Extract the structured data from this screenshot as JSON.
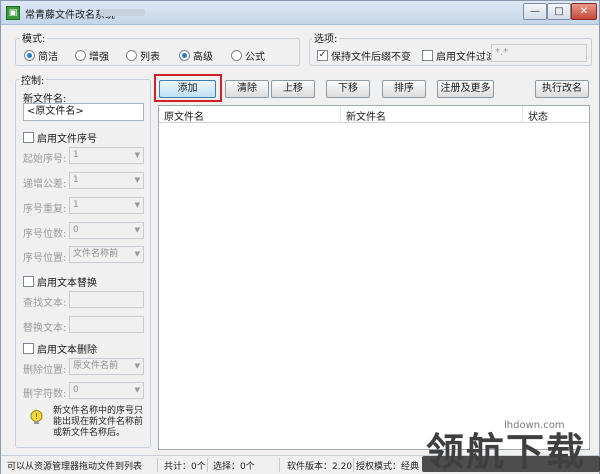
{
  "window": {
    "title": "常青藤文件改名系统",
    "icon_glyph": "▣",
    "controls": {
      "minimize": "—",
      "maximize": "□",
      "close": "✕"
    }
  },
  "mode": {
    "label": "模式:",
    "options": [
      {
        "label": "简洁",
        "selected": true
      },
      {
        "label": "增强",
        "selected": false
      },
      {
        "label": "列表",
        "selected": false
      },
      {
        "label": "高级",
        "selected": false
      },
      {
        "label": "公式",
        "selected": false
      }
    ]
  },
  "options_group": {
    "label": "选项:",
    "keep_extension": {
      "label": "保持文件后缀不变",
      "checked": true
    },
    "enable_filter": {
      "label": "启用文件过滤",
      "checked": false
    },
    "filter_value": "*.*"
  },
  "control": {
    "label": "控制:",
    "new_name_label": "新文件名:",
    "new_name_value": "<原文件名>",
    "sequence": {
      "label": "启用文件序号",
      "checked": false,
      "start_label": "起始序号:",
      "start_value": "1",
      "step_label": "递增公差:",
      "step_value": "1",
      "repeat_label": "序号重复:",
      "repeat_value": "1",
      "digits_label": "序号位数:",
      "digits_value": "0",
      "position_label": "序号位置:",
      "position_value": "文件名称前"
    },
    "replace": {
      "label": "启用文本替换",
      "checked": false,
      "find_label": "查找文本:",
      "find_value": "",
      "replace_label": "替换文本:",
      "replace_value": ""
    },
    "delete": {
      "label": "启用文本删除",
      "checked": false,
      "position_label": "删除位置:",
      "position_value": "原文件名前",
      "count_label": "删字符数:",
      "count_value": "0"
    },
    "hint": "新文件名称中的序号只能出现在新文件名称前或新文件名称后。"
  },
  "toolbar": {
    "add": "添加",
    "clear": "清除",
    "up": "上移",
    "down": "下移",
    "sort": "排序",
    "register": "注册及更多",
    "execute": "执行改名"
  },
  "file_list": {
    "columns": [
      "原文件名",
      "新文件名",
      "状态"
    ],
    "rows": []
  },
  "statusbar": {
    "hint": "可以从资源管理器拖动文件到列表",
    "total": "共计：0个",
    "selected": "选择：0个",
    "version": "软件版本：2.20",
    "license": "授权模式：经典"
  },
  "watermark": {
    "url": "lhdown.com",
    "text": "领航下载"
  },
  "colors": {
    "highlight_border": "#d0202a",
    "radio_selected": "#2a7ad0",
    "app_icon": "#3a9a3a"
  }
}
